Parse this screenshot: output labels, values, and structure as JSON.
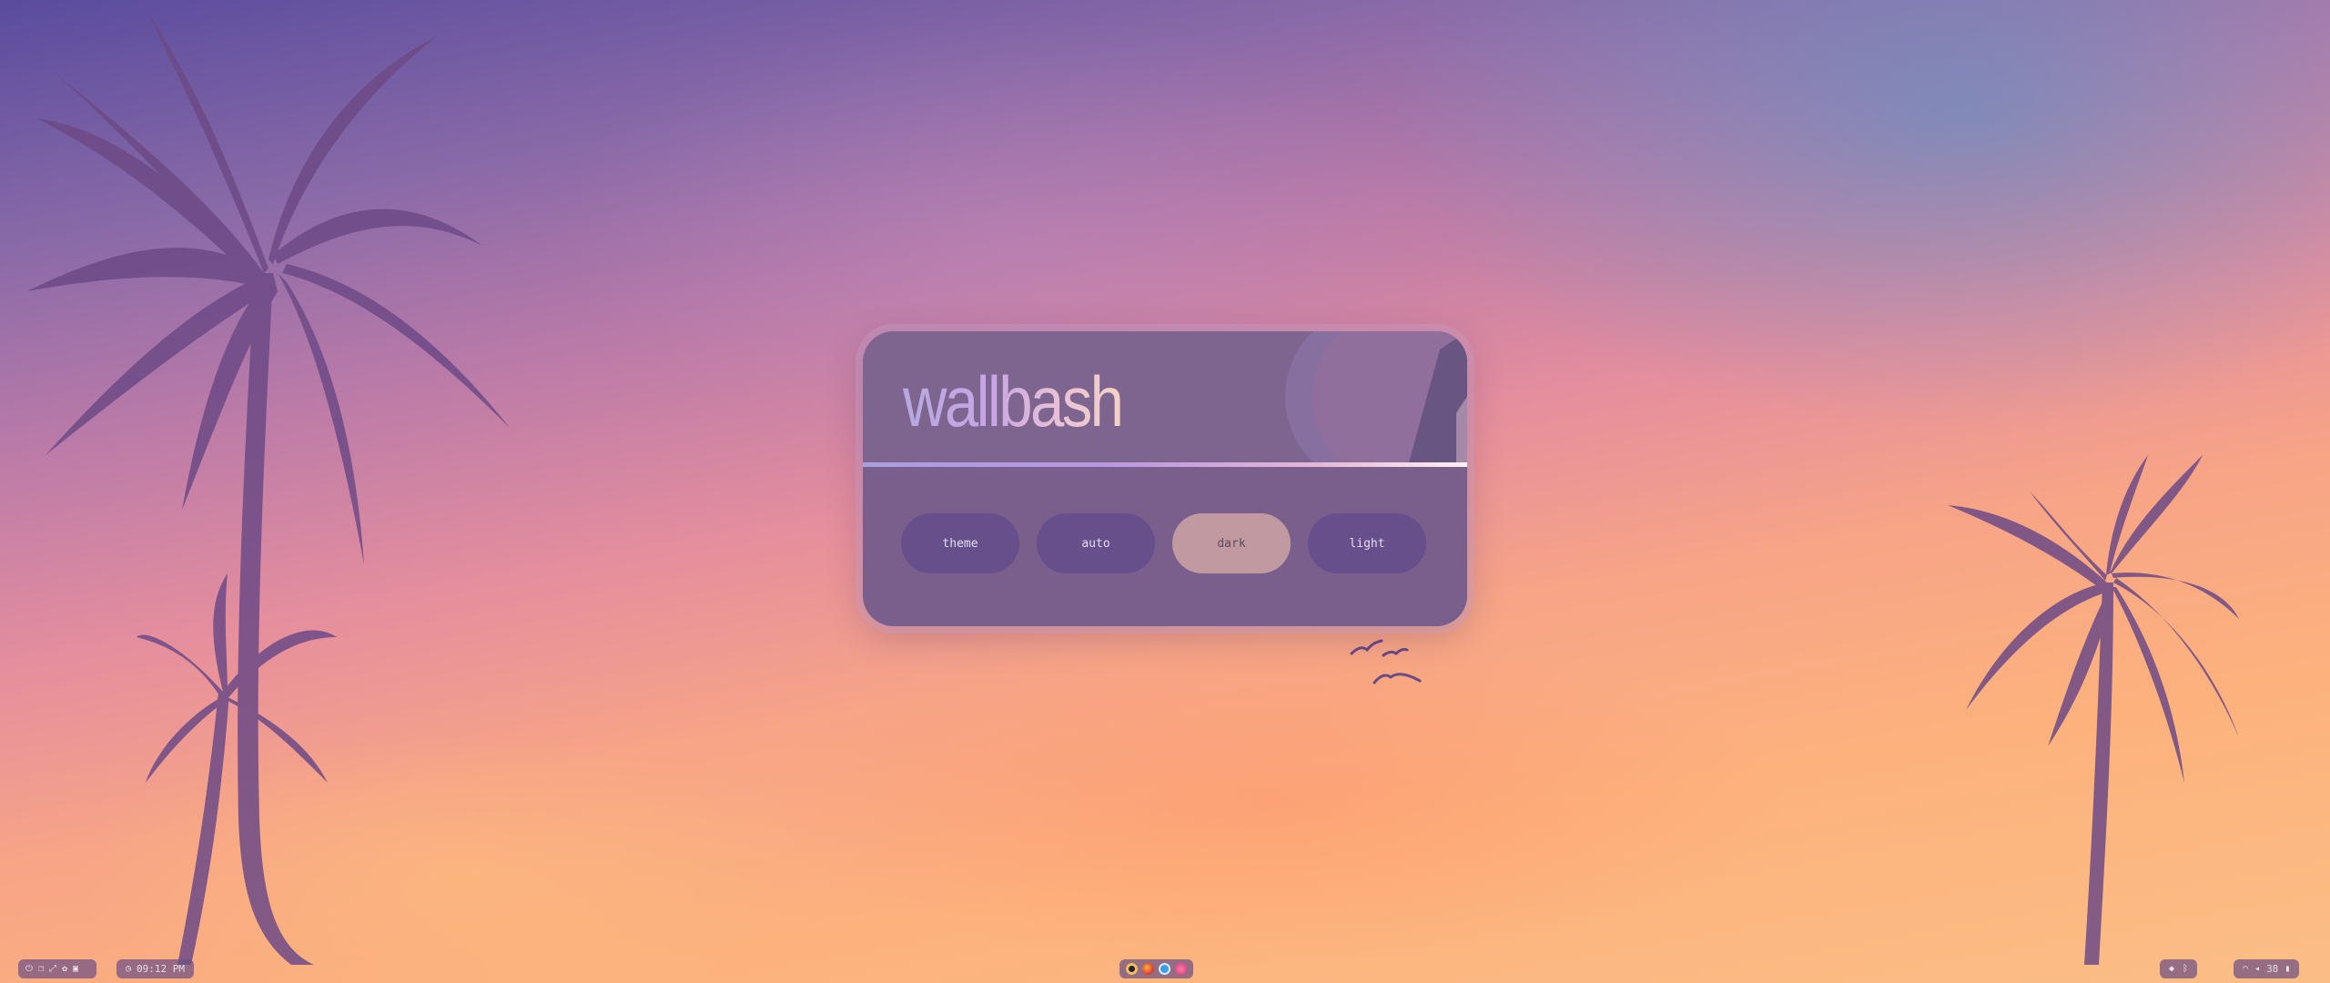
{
  "wallbash": {
    "logo_text": "wallbash",
    "modes": [
      {
        "label": "theme",
        "active": false
      },
      {
        "label": "auto",
        "active": false
      },
      {
        "label": "dark",
        "active": true
      },
      {
        "label": "light",
        "active": false
      }
    ]
  },
  "taskbar": {
    "left_icons": [
      "power-icon",
      "window-icon",
      "expand-icon",
      "palette-icon",
      "wallpaper-icon"
    ],
    "clock": "09:12 PM",
    "apps": [
      "cat-terminal-icon",
      "firefox-icon",
      "telegram-icon",
      "heart-app-icon"
    ],
    "tray": [
      "github-icon",
      "bluetooth-icon"
    ],
    "status": {
      "wifi_icon": "wifi-icon",
      "volume_icon": "volume-icon",
      "volume": "38",
      "mic_icon": "mic-icon"
    }
  },
  "colors": {
    "card_bg": "#7e6791",
    "button": "#664f8a",
    "button_active": "#c09aa0"
  }
}
